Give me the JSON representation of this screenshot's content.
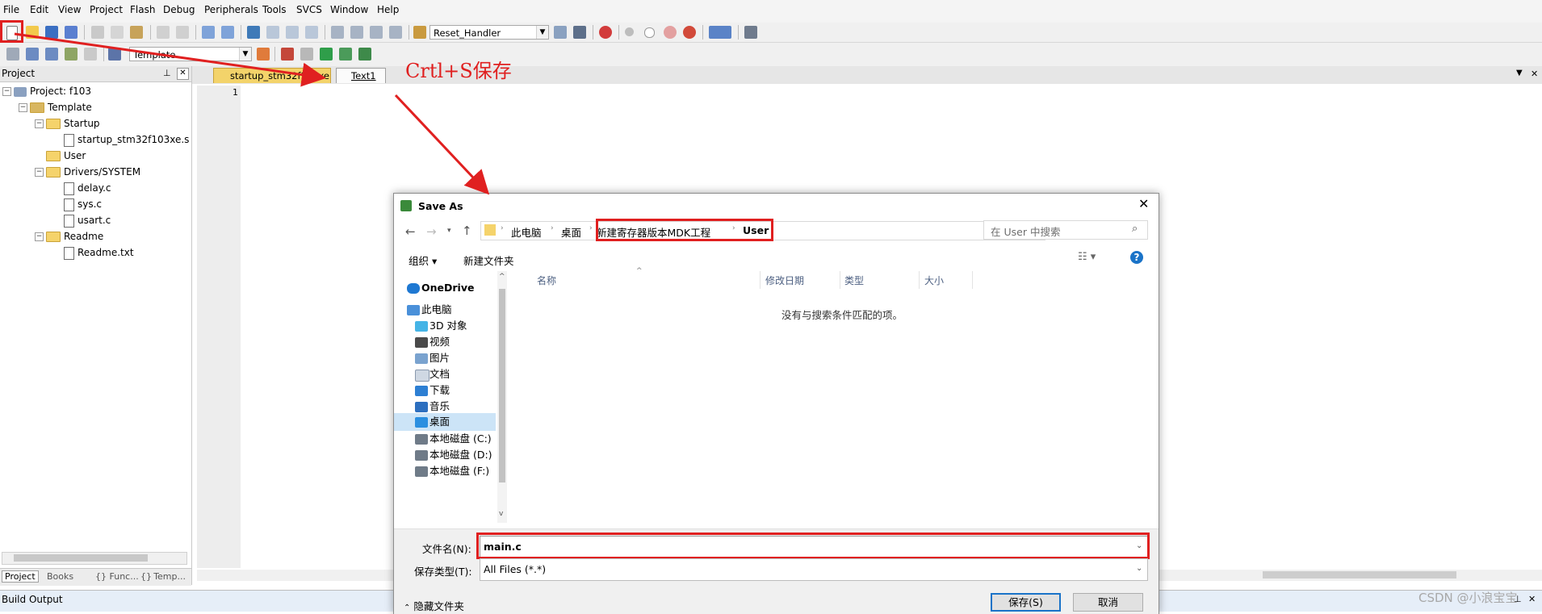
{
  "menu": [
    "File",
    "Edit",
    "View",
    "Project",
    "Flash",
    "Debug",
    "Peripherals",
    "Tools",
    "SVCS",
    "Window",
    "Help"
  ],
  "toolbar": {
    "function_combo": "Reset_Handler",
    "target_combo": "Template"
  },
  "project_pane": {
    "title": "Project",
    "tree": [
      {
        "label": "Project: f103",
        "kind": "project"
      },
      {
        "label": "Template",
        "kind": "target"
      },
      {
        "label": "Startup",
        "kind": "folder"
      },
      {
        "label": "startup_stm32f103xe.s",
        "kind": "file"
      },
      {
        "label": "User",
        "kind": "folder"
      },
      {
        "label": "Drivers/SYSTEM",
        "kind": "folder"
      },
      {
        "label": "delay.c",
        "kind": "file"
      },
      {
        "label": "sys.c",
        "kind": "file"
      },
      {
        "label": "usart.c",
        "kind": "file"
      },
      {
        "label": "Readme",
        "kind": "folder"
      },
      {
        "label": "Readme.txt",
        "kind": "file"
      }
    ],
    "bottom_tabs": [
      "Project",
      "Books",
      "{} Func...",
      "{} Temp..."
    ]
  },
  "editor": {
    "tabs": [
      "startup_stm32f103xe.s",
      "Text1"
    ],
    "line_number": "1"
  },
  "annotation": {
    "text": "Crtl+S保存",
    "color": "#e02020"
  },
  "build_output": "Build Output",
  "watermark": "CSDN @小浪宝宝",
  "dialog": {
    "title": "Save As",
    "breadcrumb": [
      "此电脑",
      "桌面",
      "新建寄存器版本MDK工程",
      "User"
    ],
    "search_placeholder": "在 User 中搜索",
    "organize": "组织",
    "new_folder": "新建文件夹",
    "columns": [
      "名称",
      "修改日期",
      "类型",
      "大小"
    ],
    "empty_message": "没有与搜索条件匹配的项。",
    "nav": [
      "OneDrive",
      "此电脑",
      "3D 对象",
      "视频",
      "图片",
      "文档",
      "下载",
      "音乐",
      "桌面",
      "本地磁盘 (C:)",
      "本地磁盘 (D:)",
      "本地磁盘 (F:)"
    ],
    "filename_label": "文件名(N):",
    "filename_value": "main.c",
    "filetype_label": "保存类型(T):",
    "filetype_value": "All Files (*.*)",
    "hide_folders": "隐藏文件夹",
    "save_button": "保存(S)",
    "cancel_button": "取消"
  },
  "colors": {
    "accent_red": "#e02020",
    "selected_nav": "#cce4f7"
  }
}
